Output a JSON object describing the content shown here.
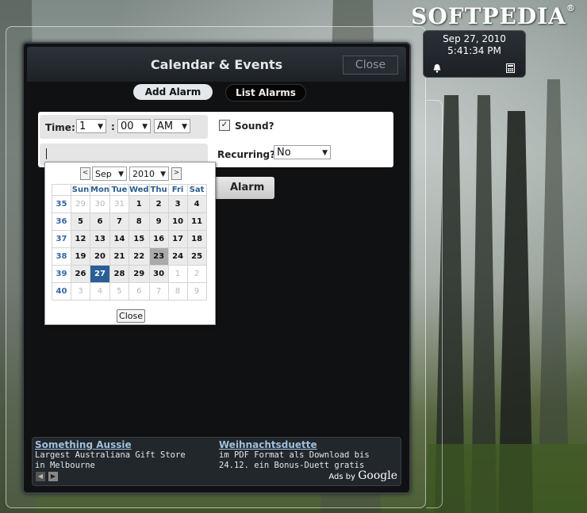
{
  "watermark": "SOFTPEDIA",
  "watermark_mark": "®",
  "clock": {
    "date": "Sep 27, 2010",
    "time": "5:41:34 PM",
    "left_icon": "alarm-bell-icon",
    "right_icon": "calculator-icon"
  },
  "panel": {
    "title": "Calendar & Events",
    "close_label": "Close"
  },
  "tabs": {
    "add": "Add Alarm",
    "list": "List Alarms"
  },
  "form": {
    "time_label": "Time:",
    "hour": "1",
    "colon": ":",
    "minute": "00",
    "ampm": "AM",
    "sound_label": "Sound?",
    "sound_checked": true,
    "check_glyph": "✓",
    "recurring_label": "Recurring?",
    "recurring_value": "No",
    "save_label": "Alarm"
  },
  "calendar": {
    "month": "Sep",
    "year": "2010",
    "prev_glyph": "<",
    "next_glyph": ">",
    "dropdown_glyph": "▼",
    "weekdays": [
      "Sun",
      "Mon",
      "Tue",
      "Wed",
      "Thu",
      "Fri",
      "Sat"
    ],
    "weeks": [
      {
        "num": "35",
        "days": [
          "29",
          "30",
          "31",
          "1",
          "2",
          "3",
          "4"
        ]
      },
      {
        "num": "36",
        "days": [
          "5",
          "6",
          "7",
          "8",
          "9",
          "10",
          "11"
        ]
      },
      {
        "num": "37",
        "days": [
          "12",
          "13",
          "14",
          "15",
          "16",
          "17",
          "18"
        ]
      },
      {
        "num": "38",
        "days": [
          "19",
          "20",
          "21",
          "22",
          "23",
          "24",
          "25"
        ]
      },
      {
        "num": "39",
        "days": [
          "26",
          "27",
          "28",
          "29",
          "30",
          "1",
          "2"
        ]
      },
      {
        "num": "40",
        "days": [
          "3",
          "4",
          "5",
          "6",
          "7",
          "8",
          "9"
        ]
      }
    ],
    "today": "23",
    "selected": "27",
    "close_label": "Close"
  },
  "ads": {
    "items": [
      {
        "title": "Something Aussie",
        "text": "Largest Australiana Gift Store in Melbourne"
      },
      {
        "title": "Weihnachtsduette",
        "text": "im PDF Format als Download bis 24.12. ein Bonus-Duett gratis"
      }
    ],
    "prev_glyph": "◀",
    "next_glyph": "▶",
    "ads_by": "Ads by",
    "google": "Google"
  },
  "colors": {
    "accent": "#2a5f96",
    "panel_bg": "#0f1113",
    "link": "#9fc0dd"
  }
}
